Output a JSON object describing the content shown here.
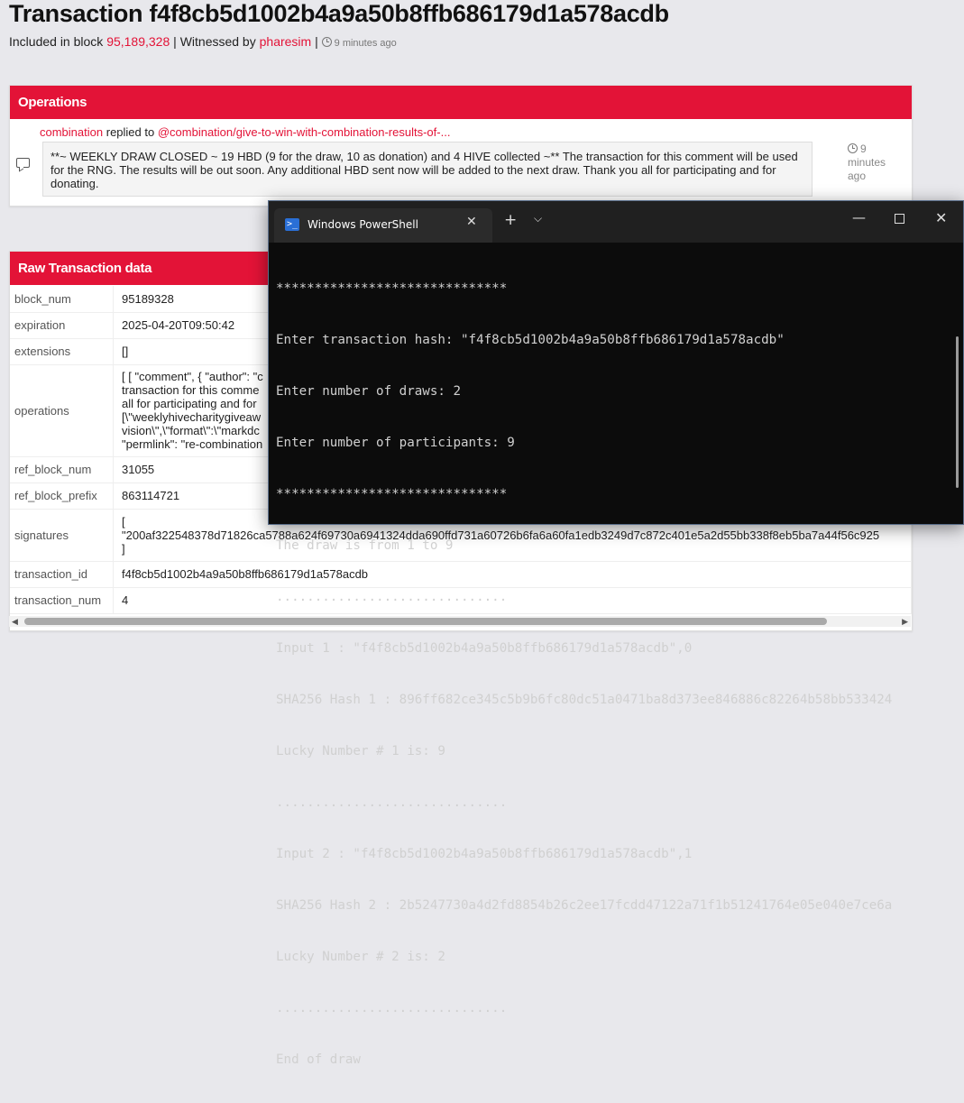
{
  "header": {
    "title": "Transaction f4f8cb5d1002b4a9a50b8ffb686179d1a578acdb",
    "included_label": "Included in block",
    "block_number": "95,189,328",
    "witnessed_label": "Witnessed by",
    "witness": "pharesim",
    "time": "9 minutes ago"
  },
  "operations": {
    "header": "Operations",
    "author": "combination",
    "action": "replied to",
    "parent_link": "@combination/give-to-win-with-combination-results-of-...",
    "body": "**~ WEEKLY DRAW CLOSED ~ 19 HBD (9 for the draw, 10 as donation) and 4 HIVE collected ~** The transaction for this comment will be used for the RNG. The results will be out soon. Any additional HBD sent now will be added to the next draw. Thank you all for participating and for donating.",
    "time_line1": "9",
    "time_line2": "minutes",
    "time_line3": "ago"
  },
  "raw": {
    "header": "Raw Transaction data",
    "rows": [
      {
        "key": "block_num",
        "value": "95189328"
      },
      {
        "key": "expiration",
        "value": "2025-04-20T09:50:42"
      },
      {
        "key": "extensions",
        "value": "[]"
      },
      {
        "key": "operations",
        "lines": [
          "[ [ \"comment\", { \"author\": \"c",
          "transaction for this comme",
          "all for participating and for",
          "[\\\"weeklyhivecharitygiveaw",
          "vision\\\",\\\"format\\\":\\\"markdc",
          "\"permlink\": \"re-combination"
        ]
      },
      {
        "key": "ref_block_num",
        "value": "31055"
      },
      {
        "key": "ref_block_prefix",
        "value": "863114721"
      },
      {
        "key": "signatures",
        "lines": [
          "[",
          "\"200af322548378d71826ca5788a624f69730a6941324dda690ffd731a60726b6fa6a60fa1edb3249d7c872c401e5a2d55bb338f8eb5ba7a44f56c925",
          "]"
        ]
      },
      {
        "key": "transaction_id",
        "value": "f4f8cb5d1002b4a9a50b8ffb686179d1a578acdb"
      },
      {
        "key": "transaction_num",
        "value": "4"
      }
    ]
  },
  "powershell": {
    "tab_title": "Windows PowerShell",
    "lines": [
      "******************************",
      "Enter transaction hash: \"f4f8cb5d1002b4a9a50b8ffb686179d1a578acdb\"",
      "Enter number of draws: 2",
      "Enter number of participants: 9",
      "******************************",
      "The draw is from 1 to 9",
      "..............................",
      "Input 1 : \"f4f8cb5d1002b4a9a50b8ffb686179d1a578acdb\",0",
      "SHA256 Hash 1 : 896ff682ce345c5b9b6fc80dc51a0471ba8d373ee846886c82264b58bb533424",
      "Lucky Number # 1 is: 9",
      "..............................",
      "Input 2 : \"f4f8cb5d1002b4a9a50b8ffb686179d1a578acdb\",1",
      "SHA256 Hash 2 : 2b5247730a4d2fd8854b26c2ee17fcdd47122a71f1b51241764e05e040e7ce6a",
      "Lucky Number # 2 is: 2",
      "..............................",
      "End of draw"
    ]
  }
}
